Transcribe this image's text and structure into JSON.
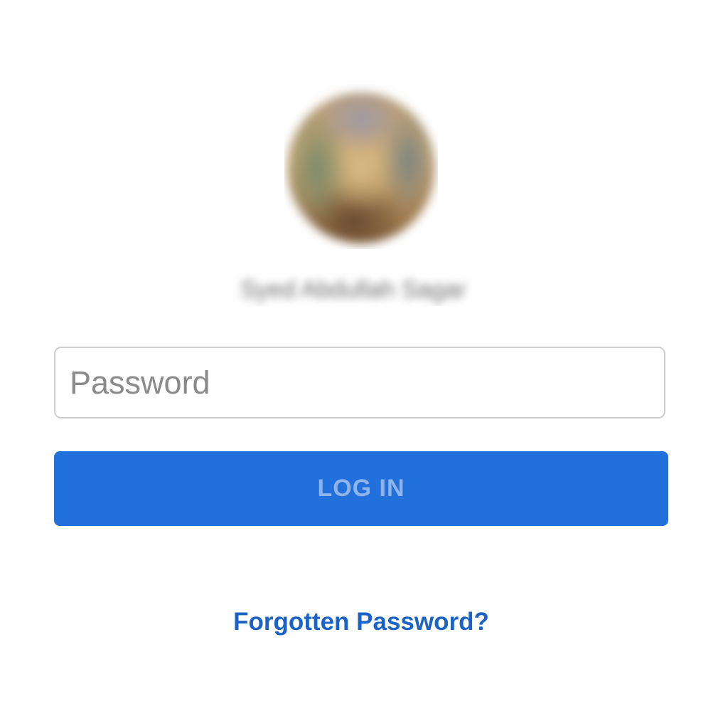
{
  "profile": {
    "avatar_icon": "profile-photo",
    "name": "Syed Abdullah Sagar"
  },
  "login": {
    "password_placeholder": "Password",
    "password_value": "",
    "login_label": "LOG IN",
    "forgot_label": "Forgotten Password?"
  },
  "colors": {
    "accent": "#2270db",
    "button_text": "#8fb4ec",
    "link": "#1b63c7",
    "field_border": "#cfcfcf"
  }
}
